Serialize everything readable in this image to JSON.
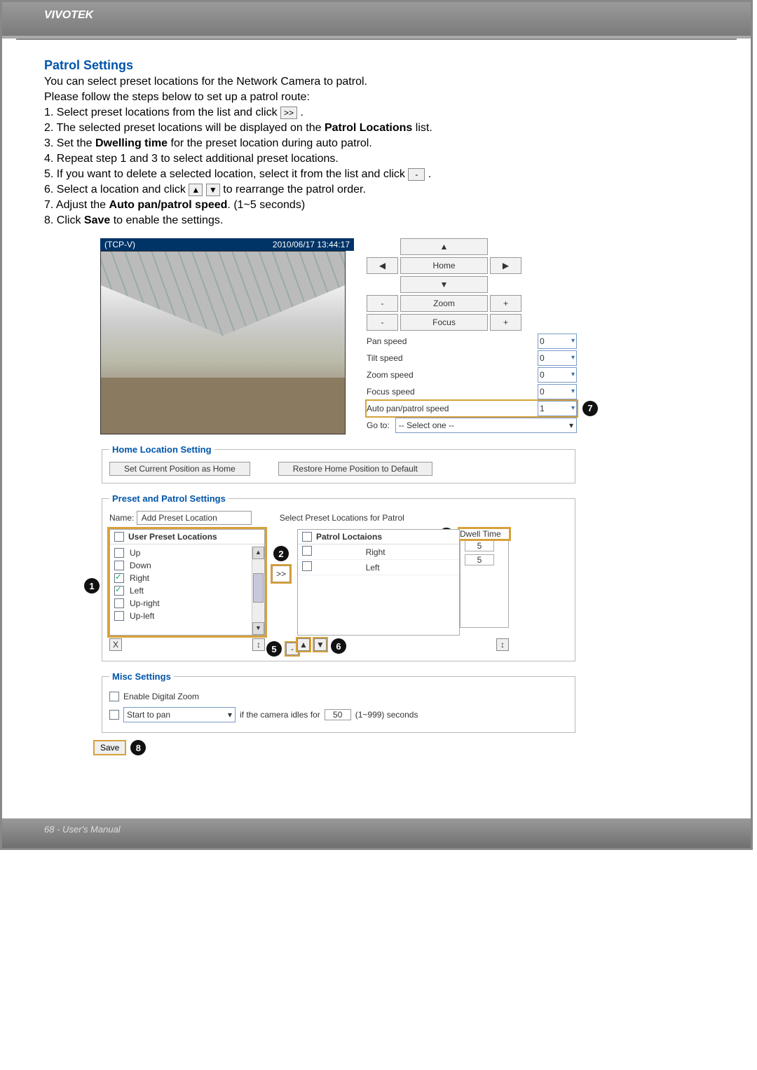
{
  "brand": "VIVOTEK",
  "footer": "68 - User's Manual",
  "title": "Patrol Settings",
  "intro1": "You can select preset locations for the Network Camera to patrol.",
  "intro2": "Please follow the steps below to set up a patrol route:",
  "steps": {
    "s1a": "1. Select preset locations from the list and click ",
    "s1b": ".",
    "s2a": "2. The selected preset locations will be displayed on the ",
    "s2b": "Patrol Locations",
    "s2c": " list.",
    "s3a": "3. Set the ",
    "s3b": "Dwelling time",
    "s3c": " for the preset location during auto patrol.",
    "s4": "4. Repeat step 1 and 3 to select additional preset locations.",
    "s5a": "5. If you want to delete a selected location, select it from the list and click ",
    "s5b": ".",
    "s6a": "6. Select a location and click ",
    "s6b": " to rearrange the patrol order.",
    "s7a": "7. Adjust the ",
    "s7b": "Auto pan/patrol speed",
    "s7c": ". (1~5 seconds)",
    "s8a": "8. Click ",
    "s8b": "Save",
    "s8c": " to enable the settings."
  },
  "icons": {
    "fwd": ">>",
    "del": "-",
    "up": "▲",
    "down": "▼",
    "left": "◀",
    "right": "▶",
    "plus": "+",
    "minus": "-",
    "x": "X",
    "sort": "↕",
    "chev": "▾"
  },
  "video": {
    "title": "(TCP-V)",
    "time": "2010/06/17 13:44:17"
  },
  "ptz": {
    "home": "Home",
    "zoom": "Zoom",
    "focus": "Focus",
    "pan_speed": "Pan speed",
    "tilt_speed": "Tilt speed",
    "zoom_speed": "Zoom speed",
    "focus_speed": "Focus speed",
    "auto_speed": "Auto pan/patrol speed",
    "goto": "Go to:",
    "goto_value": "-- Select one --",
    "v0": "0",
    "v1": "1"
  },
  "home": {
    "legend": "Home Location Setting",
    "set": "Set Current Position as Home",
    "restore": "Restore Home Position to Default"
  },
  "preset": {
    "legend": "Preset and Patrol Settings",
    "name_label": "Name:",
    "name_value": "Add Preset Location",
    "select_label": "Select Preset Locations for Patrol",
    "user_hdr": "User Preset Locations",
    "patrol_hdr": "Patrol Loctaions",
    "dwell_hdr": "Dwell Time",
    "user_list": [
      {
        "label": "Up",
        "checked": false
      },
      {
        "label": "Down",
        "checked": false
      },
      {
        "label": "Right",
        "checked": true
      },
      {
        "label": "Left",
        "checked": true
      },
      {
        "label": "Up-right",
        "checked": false
      },
      {
        "label": "Up-left",
        "checked": false
      }
    ],
    "patrol_list": [
      {
        "label": "Right",
        "dwell": "5"
      },
      {
        "label": "Left",
        "dwell": "5"
      }
    ]
  },
  "misc": {
    "legend": "Misc Settings",
    "enable_zoom": "Enable Digital Zoom",
    "idle_action": "Start to pan",
    "idle_mid": " if the camera idles for ",
    "idle_value": "50",
    "idle_range": "(1~999) seconds"
  },
  "save": "Save",
  "callouts": {
    "c1": "1",
    "c2": "2",
    "c3": "3",
    "c4": "",
    "c5": "5",
    "c6": "6",
    "c7": "7",
    "c8": "8"
  }
}
